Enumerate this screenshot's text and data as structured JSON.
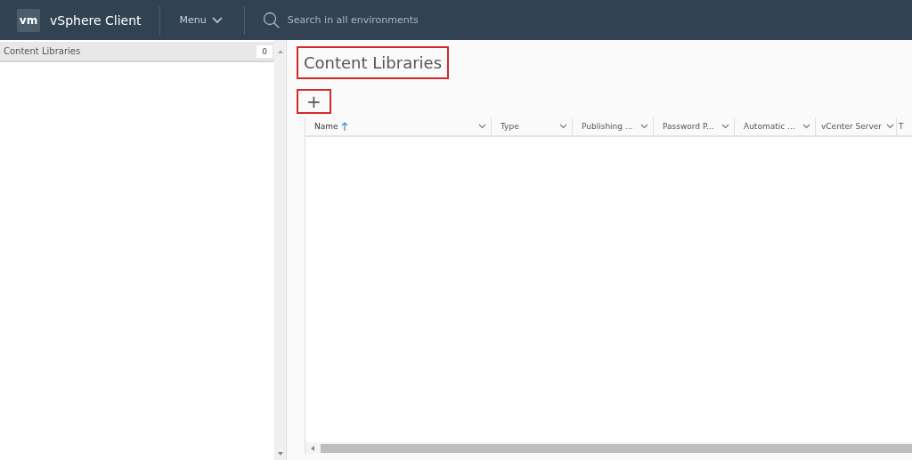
{
  "header": {
    "logo": "vm",
    "title": "vSphere Client",
    "menu": "Menu",
    "search": {
      "placeholder": "Search in all environments"
    }
  },
  "sidebar": {
    "title": "Content Libraries",
    "count": "0"
  },
  "main": {
    "title": "Content Libraries",
    "add_button": "+",
    "table": {
      "columns": [
        {
          "label": "Name",
          "sorted": true
        },
        {
          "label": "Type",
          "sorted": false
        },
        {
          "label": "Publishing ...",
          "sorted": false
        },
        {
          "label": "Password P...",
          "sorted": false
        },
        {
          "label": "Automatic ...",
          "sorted": false
        },
        {
          "label": "vCenter Server",
          "sorted": false
        },
        {
          "label": "T",
          "sorted": false
        }
      ]
    }
  }
}
